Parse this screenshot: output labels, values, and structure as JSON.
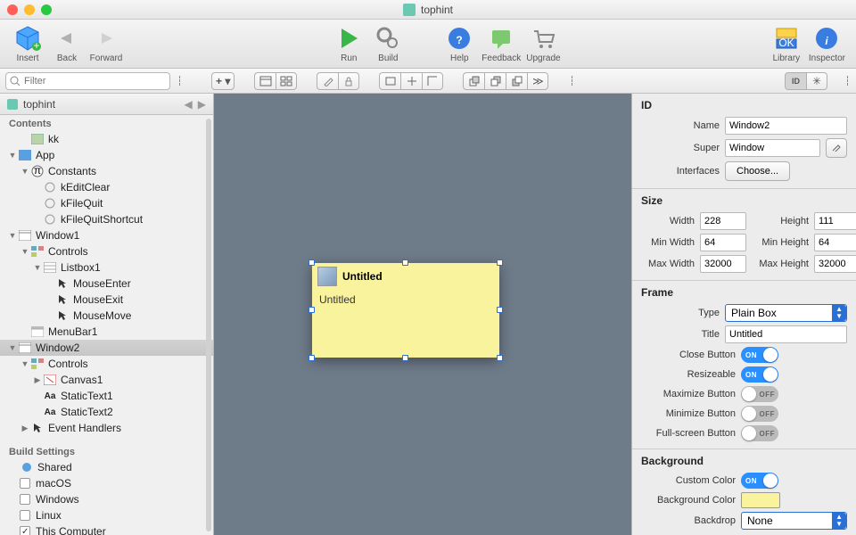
{
  "title": "tophint",
  "toolbar": {
    "insert": "Insert",
    "back": "Back",
    "forward": "Forward",
    "run": "Run",
    "build": "Build",
    "help": "Help",
    "feedback": "Feedback",
    "upgrade": "Upgrade",
    "library": "Library",
    "inspector": "Inspector"
  },
  "search_placeholder": "Filter",
  "nav": {
    "header": "tophint",
    "contents_label": "Contents",
    "build_settings_label": "Build Settings",
    "items": [
      {
        "label": "kk"
      },
      {
        "label": "App"
      },
      {
        "label": "Constants"
      },
      {
        "label": "kEditClear"
      },
      {
        "label": "kFileQuit"
      },
      {
        "label": "kFileQuitShortcut"
      },
      {
        "label": "Window1"
      },
      {
        "label": "Controls"
      },
      {
        "label": "Listbox1"
      },
      {
        "label": "MouseEnter"
      },
      {
        "label": "MouseExit"
      },
      {
        "label": "MouseMove"
      },
      {
        "label": "MenuBar1"
      },
      {
        "label": "Window2"
      },
      {
        "label": "Controls"
      },
      {
        "label": "Canvas1"
      },
      {
        "label": "StaticText1"
      },
      {
        "label": "StaticText2"
      },
      {
        "label": "Event Handlers"
      }
    ],
    "build_items": [
      {
        "label": "Shared"
      },
      {
        "label": "macOS"
      },
      {
        "label": "Windows"
      },
      {
        "label": "Linux"
      },
      {
        "label": "This Computer"
      }
    ]
  },
  "preview": {
    "title": "Untitled",
    "body": "Untitled"
  },
  "inspector": {
    "id_label": "ID",
    "name_label": "Name",
    "name_value": "Window2",
    "super_label": "Super",
    "super_value": "Window",
    "interfaces_label": "Interfaces",
    "choose": "Choose...",
    "size_label": "Size",
    "width_label": "Width",
    "width_value": "228",
    "height_label": "Height",
    "height_value": "111",
    "minw_label": "Min Width",
    "minw_value": "64",
    "minh_label": "Min Height",
    "minh_value": "64",
    "maxw_label": "Max Width",
    "maxw_value": "32000",
    "maxh_label": "Max Height",
    "maxh_value": "32000",
    "frame_label": "Frame",
    "type_label": "Type",
    "type_value": "Plain Box",
    "title_label": "Title",
    "title_value": "Untitled",
    "close_label": "Close Button",
    "resize_label": "Resizeable",
    "maximize_label": "Maximize Button",
    "minimize_label": "Minimize Button",
    "fullscreen_label": "Full-screen Button",
    "background_label": "Background",
    "custom_color_label": "Custom Color",
    "background_color_label": "Background Color",
    "backdrop_label": "Backdrop",
    "backdrop_value": "None",
    "on": "ON",
    "off": "OFF"
  }
}
